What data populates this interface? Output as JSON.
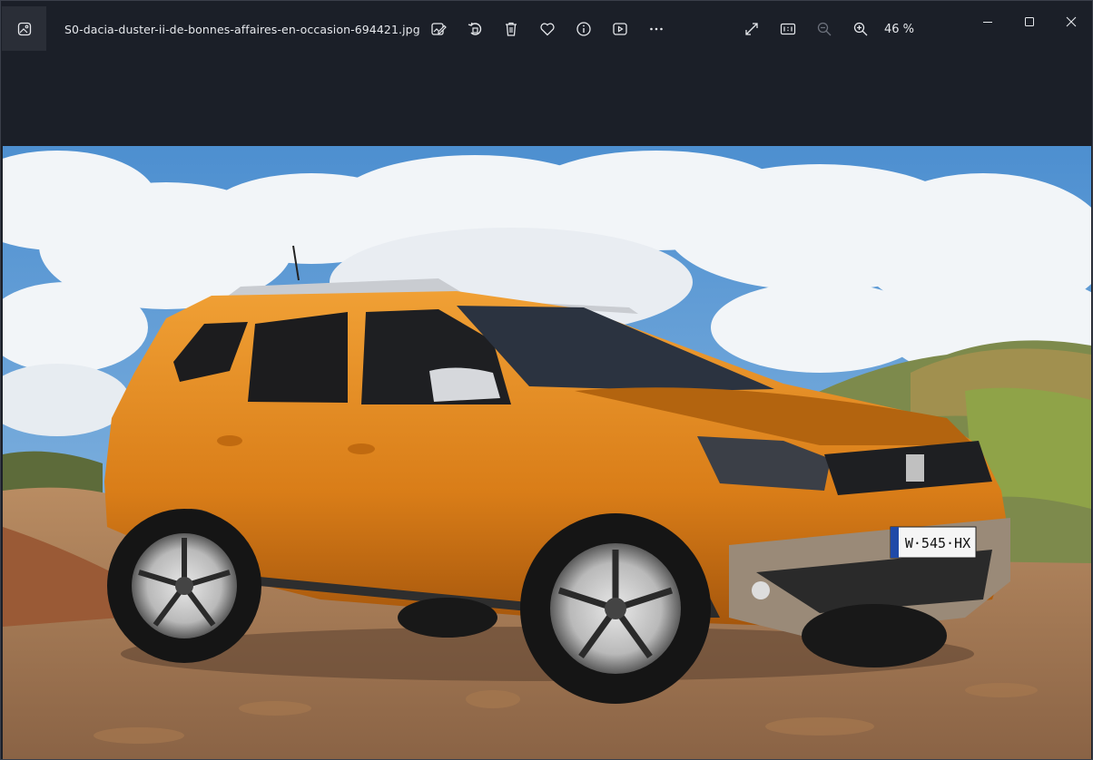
{
  "window": {
    "filename": "S0-dacia-duster-ii-de-bonnes-affaires-en-occasion-694421.jpg",
    "zoom_label": "46 %"
  },
  "toolbar": {
    "icons": [
      "app-icon",
      "edit-image-icon",
      "rotate-icon",
      "delete-icon",
      "favorite-icon",
      "info-icon",
      "slideshow-icon",
      "more-icon",
      "fullscreen-icon",
      "actual-size-icon",
      "zoom-out-icon",
      "zoom-in-icon"
    ]
  },
  "window_controls": [
    "minimize-icon",
    "maximize-icon",
    "close-icon"
  ],
  "photo": {
    "subject": "orange suv",
    "plate_text": "W·545·HX"
  },
  "colors": {
    "chrome_bg": "#1b1f28",
    "icon_fg": "#e6e8ec",
    "car_orange": "#e08a1e",
    "sky": "#5f9fd6"
  }
}
